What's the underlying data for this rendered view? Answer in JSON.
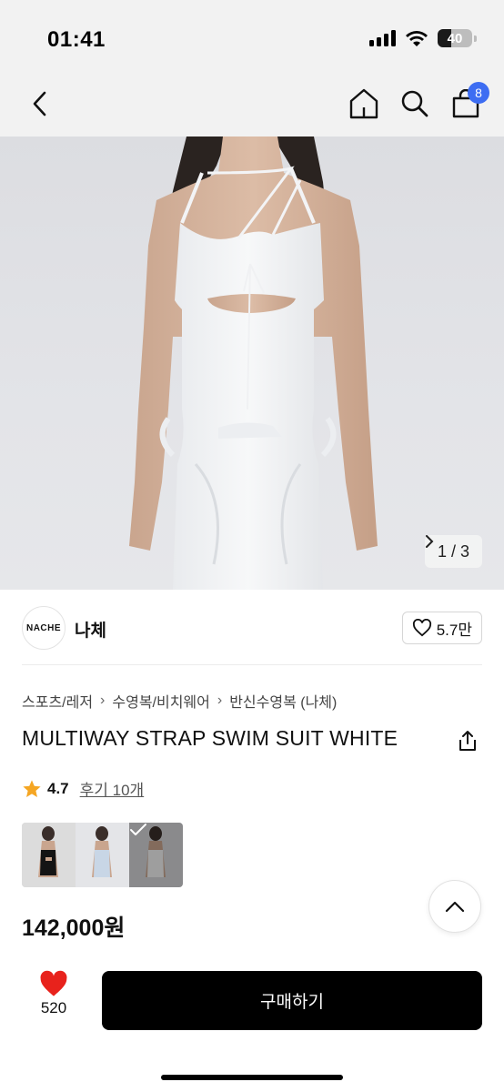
{
  "status_bar": {
    "time": "01:41",
    "battery_level": "40",
    "signal_icon": "cellular-signal-icon",
    "wifi_icon": "wifi-icon"
  },
  "nav": {
    "back_icon": "chevron-left-icon",
    "home_icon": "home-icon",
    "search_icon": "search-icon",
    "cart_icon": "shopping-bag-icon",
    "cart_count": "8",
    "accent_color": "#3d6df2"
  },
  "gallery": {
    "counter": "1 / 3",
    "current": 1,
    "total": 3
  },
  "brand": {
    "logo_text": "NACHE",
    "name": "나체",
    "like_count": "5.7만",
    "like_icon": "heart-outline-icon"
  },
  "breadcrumb": {
    "items": [
      "스포츠/레저",
      "수영복/비치웨어",
      "반신수영복 (나체)"
    ]
  },
  "product": {
    "title": "MULTIWAY STRAP SWIM SUIT WHITE",
    "share_icon": "share-icon",
    "rating": "4.7",
    "star_icon": "star-icon",
    "star_color": "#f5a623",
    "review_link": "후기 10개",
    "price": "142,000원",
    "swatches": [
      "black",
      "light-blue",
      "white"
    ],
    "selected_swatch": "white"
  },
  "bottom_bar": {
    "wish_icon": "heart-filled-icon",
    "wish_color": "#e8221c",
    "wish_count": "520",
    "buy_label": "구매하기",
    "scroll_top_icon": "chevron-up-icon"
  }
}
